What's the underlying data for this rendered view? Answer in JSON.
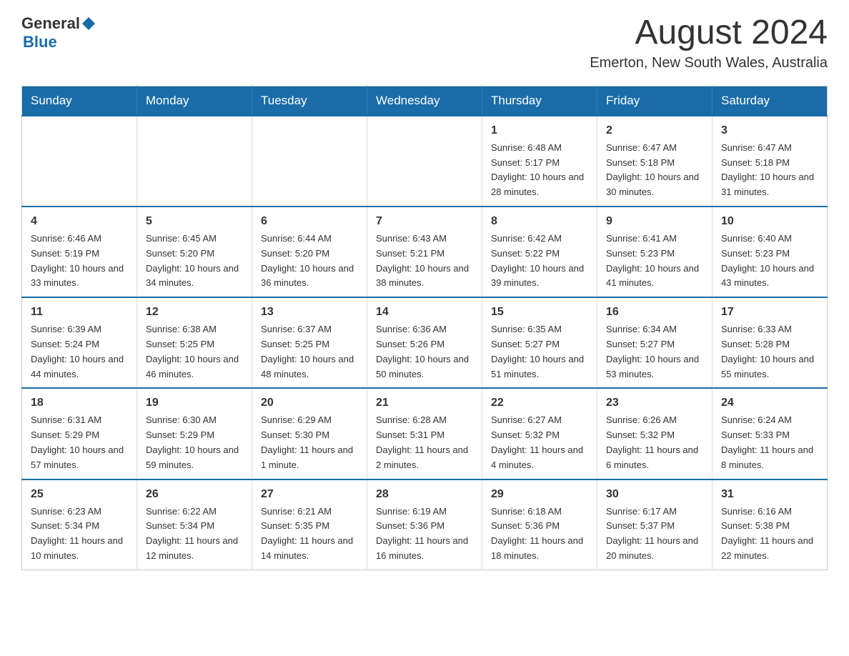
{
  "header": {
    "logo": {
      "general": "General",
      "blue": "Blue"
    },
    "title": "August 2024",
    "location": "Emerton, New South Wales, Australia"
  },
  "calendar": {
    "days_of_week": [
      "Sunday",
      "Monday",
      "Tuesday",
      "Wednesday",
      "Thursday",
      "Friday",
      "Saturday"
    ],
    "weeks": [
      [
        {
          "day": "",
          "info": ""
        },
        {
          "day": "",
          "info": ""
        },
        {
          "day": "",
          "info": ""
        },
        {
          "day": "",
          "info": ""
        },
        {
          "day": "1",
          "info": "Sunrise: 6:48 AM\nSunset: 5:17 PM\nDaylight: 10 hours and 28 minutes."
        },
        {
          "day": "2",
          "info": "Sunrise: 6:47 AM\nSunset: 5:18 PM\nDaylight: 10 hours and 30 minutes."
        },
        {
          "day": "3",
          "info": "Sunrise: 6:47 AM\nSunset: 5:18 PM\nDaylight: 10 hours and 31 minutes."
        }
      ],
      [
        {
          "day": "4",
          "info": "Sunrise: 6:46 AM\nSunset: 5:19 PM\nDaylight: 10 hours and 33 minutes."
        },
        {
          "day": "5",
          "info": "Sunrise: 6:45 AM\nSunset: 5:20 PM\nDaylight: 10 hours and 34 minutes."
        },
        {
          "day": "6",
          "info": "Sunrise: 6:44 AM\nSunset: 5:20 PM\nDaylight: 10 hours and 36 minutes."
        },
        {
          "day": "7",
          "info": "Sunrise: 6:43 AM\nSunset: 5:21 PM\nDaylight: 10 hours and 38 minutes."
        },
        {
          "day": "8",
          "info": "Sunrise: 6:42 AM\nSunset: 5:22 PM\nDaylight: 10 hours and 39 minutes."
        },
        {
          "day": "9",
          "info": "Sunrise: 6:41 AM\nSunset: 5:23 PM\nDaylight: 10 hours and 41 minutes."
        },
        {
          "day": "10",
          "info": "Sunrise: 6:40 AM\nSunset: 5:23 PM\nDaylight: 10 hours and 43 minutes."
        }
      ],
      [
        {
          "day": "11",
          "info": "Sunrise: 6:39 AM\nSunset: 5:24 PM\nDaylight: 10 hours and 44 minutes."
        },
        {
          "day": "12",
          "info": "Sunrise: 6:38 AM\nSunset: 5:25 PM\nDaylight: 10 hours and 46 minutes."
        },
        {
          "day": "13",
          "info": "Sunrise: 6:37 AM\nSunset: 5:25 PM\nDaylight: 10 hours and 48 minutes."
        },
        {
          "day": "14",
          "info": "Sunrise: 6:36 AM\nSunset: 5:26 PM\nDaylight: 10 hours and 50 minutes."
        },
        {
          "day": "15",
          "info": "Sunrise: 6:35 AM\nSunset: 5:27 PM\nDaylight: 10 hours and 51 minutes."
        },
        {
          "day": "16",
          "info": "Sunrise: 6:34 AM\nSunset: 5:27 PM\nDaylight: 10 hours and 53 minutes."
        },
        {
          "day": "17",
          "info": "Sunrise: 6:33 AM\nSunset: 5:28 PM\nDaylight: 10 hours and 55 minutes."
        }
      ],
      [
        {
          "day": "18",
          "info": "Sunrise: 6:31 AM\nSunset: 5:29 PM\nDaylight: 10 hours and 57 minutes."
        },
        {
          "day": "19",
          "info": "Sunrise: 6:30 AM\nSunset: 5:29 PM\nDaylight: 10 hours and 59 minutes."
        },
        {
          "day": "20",
          "info": "Sunrise: 6:29 AM\nSunset: 5:30 PM\nDaylight: 11 hours and 1 minute."
        },
        {
          "day": "21",
          "info": "Sunrise: 6:28 AM\nSunset: 5:31 PM\nDaylight: 11 hours and 2 minutes."
        },
        {
          "day": "22",
          "info": "Sunrise: 6:27 AM\nSunset: 5:32 PM\nDaylight: 11 hours and 4 minutes."
        },
        {
          "day": "23",
          "info": "Sunrise: 6:26 AM\nSunset: 5:32 PM\nDaylight: 11 hours and 6 minutes."
        },
        {
          "day": "24",
          "info": "Sunrise: 6:24 AM\nSunset: 5:33 PM\nDaylight: 11 hours and 8 minutes."
        }
      ],
      [
        {
          "day": "25",
          "info": "Sunrise: 6:23 AM\nSunset: 5:34 PM\nDaylight: 11 hours and 10 minutes."
        },
        {
          "day": "26",
          "info": "Sunrise: 6:22 AM\nSunset: 5:34 PM\nDaylight: 11 hours and 12 minutes."
        },
        {
          "day": "27",
          "info": "Sunrise: 6:21 AM\nSunset: 5:35 PM\nDaylight: 11 hours and 14 minutes."
        },
        {
          "day": "28",
          "info": "Sunrise: 6:19 AM\nSunset: 5:36 PM\nDaylight: 11 hours and 16 minutes."
        },
        {
          "day": "29",
          "info": "Sunrise: 6:18 AM\nSunset: 5:36 PM\nDaylight: 11 hours and 18 minutes."
        },
        {
          "day": "30",
          "info": "Sunrise: 6:17 AM\nSunset: 5:37 PM\nDaylight: 11 hours and 20 minutes."
        },
        {
          "day": "31",
          "info": "Sunrise: 6:16 AM\nSunset: 5:38 PM\nDaylight: 11 hours and 22 minutes."
        }
      ]
    ]
  }
}
